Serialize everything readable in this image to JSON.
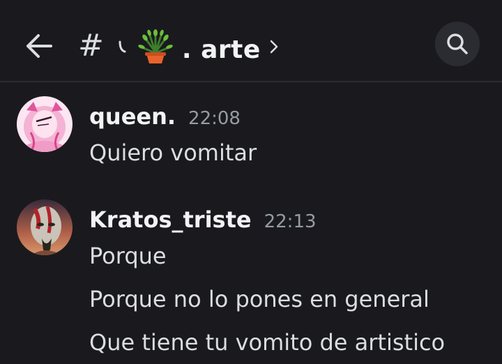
{
  "header": {
    "back_icon": "arrow-left-icon",
    "channel_prefix": "#",
    "channel_name": ". arte",
    "channel_emoji": "potted-plant",
    "chevron_icon": "chevron-right-icon",
    "search_icon": "search-icon"
  },
  "messages": [
    {
      "username": "queen.",
      "timestamp": "22:08",
      "lines": [
        "Quiero vomitar"
      ]
    },
    {
      "username": "Kratos_triste",
      "timestamp": "22:13",
      "lines": [
        "Porque",
        "Porque no lo pones en general",
        "Que tiene tu vomito de artistico"
      ]
    }
  ],
  "colors": {
    "background": "#1a1a1e",
    "header_divider": "#2b2c31",
    "text_primary": "#f2f3f5",
    "text_body": "#dbdee1",
    "text_muted": "#949ba4",
    "search_bg": "#2b2c31"
  }
}
